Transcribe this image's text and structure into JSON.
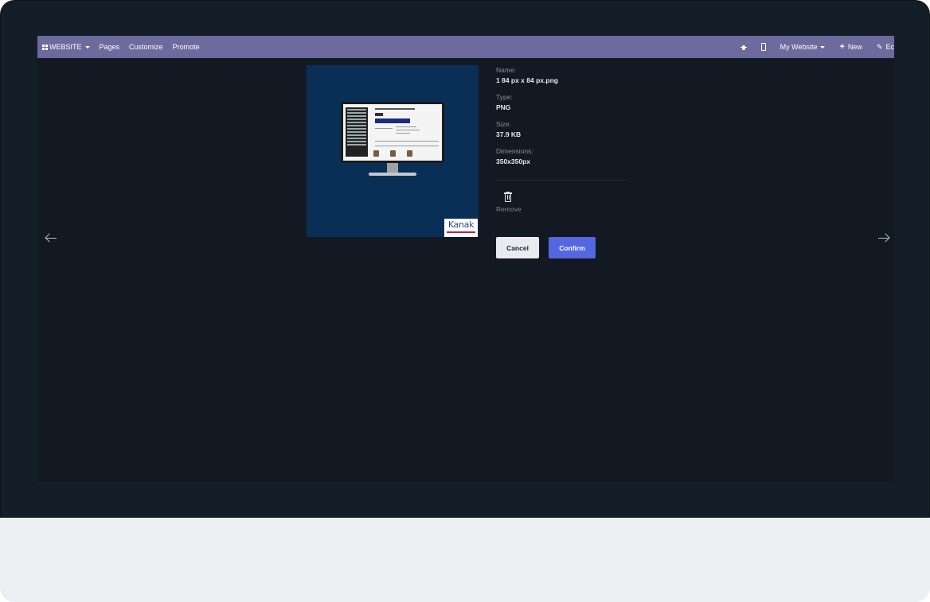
{
  "navbar": {
    "app_label": "WEBSITE",
    "menu": [
      "Pages",
      "Customize",
      "Promote"
    ],
    "website_selector": "My Website",
    "new_label": "New",
    "edit_label": "Ec",
    "color": "#6d6a9e"
  },
  "preview": {
    "logo_text": "Kanak",
    "background": "#0a2f57"
  },
  "info": {
    "name_label": "Name:",
    "name_value": "1 84 px x 84 px.png",
    "type_label": "Type:",
    "type_value": "PNG",
    "size_label": "Size:",
    "size_value": "37.9 KB",
    "dimensions_label": "Dimensions:",
    "dimensions_value": "350x350px"
  },
  "actions": {
    "remove_label": "Remove",
    "cancel_label": "Cancel",
    "confirm_label": "Confirm",
    "confirm_color": "#5467e0"
  },
  "icons": [
    "apps-icon",
    "caret-down-icon",
    "bug-icon",
    "mobile-icon",
    "plus-icon",
    "pencil-icon",
    "trash-icon",
    "arrow-left-icon",
    "arrow-right-icon"
  ]
}
